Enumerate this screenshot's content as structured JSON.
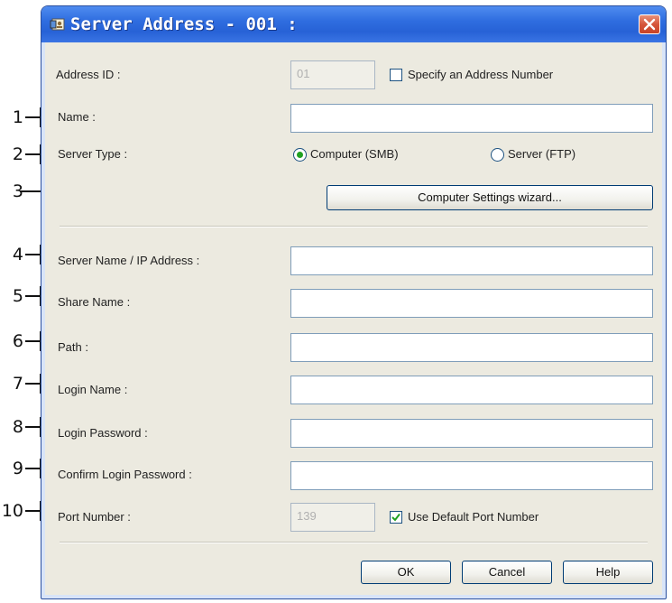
{
  "window": {
    "title": "Server Address - 001 :",
    "close_icon": "close-icon"
  },
  "callouts": [
    "1",
    "2",
    "3",
    "4",
    "5",
    "6",
    "7",
    "8",
    "9",
    "10"
  ],
  "form": {
    "address_id_label": "Address ID :",
    "address_id_value": "01",
    "specify_address_label": "Specify an Address Number",
    "specify_address_checked": false,
    "name_label": "Name :",
    "name_value": "",
    "server_type_label": "Server Type :",
    "server_type_options": [
      "Computer (SMB)",
      "Server (FTP)"
    ],
    "server_type_selected": "Computer (SMB)",
    "wizard_button": "Computer Settings wizard...",
    "server_name_label": "Server Name / IP Address :",
    "share_name_label": "Share Name :",
    "path_label": "Path :",
    "login_name_label": "Login Name :",
    "login_password_label": "Login Password :",
    "confirm_password_label": "Confirm Login Password :",
    "port_number_label": "Port Number :",
    "port_number_value": "139",
    "use_default_port_label": "Use Default Port Number",
    "use_default_port_checked": true
  },
  "buttons": {
    "ok": "OK",
    "cancel": "Cancel",
    "help": "Help"
  },
  "colors": {
    "titlebar": "#2f6de0",
    "close": "#d5553a",
    "radio_dot": "#21a121",
    "check": "#21a121"
  }
}
